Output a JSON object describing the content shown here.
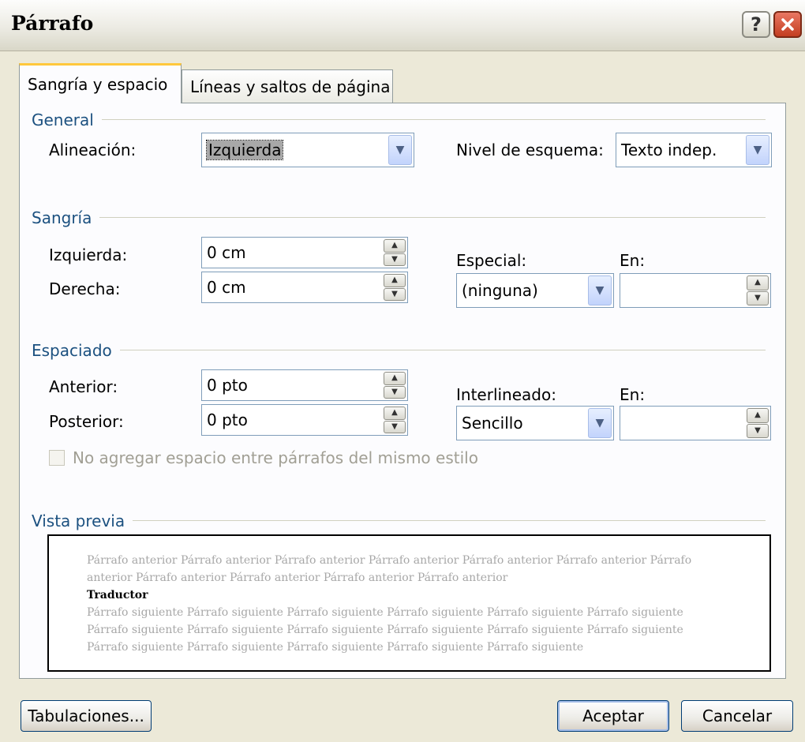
{
  "window": {
    "title": "Párrafo",
    "help_label": "?",
    "close_label": "✕"
  },
  "tabs": [
    {
      "label": "Sangría y espacio",
      "active": true
    },
    {
      "label": "Líneas y saltos de página",
      "active": false
    }
  ],
  "general": {
    "section_title": "General",
    "alineacion_label": "Alineación:",
    "alineacion_value": "Izquierda",
    "nivel_label": "Nivel de esquema:",
    "nivel_value": "Texto indep."
  },
  "sangria": {
    "section_title": "Sangría",
    "izquierda_label": "Izquierda:",
    "izquierda_value": "0 cm",
    "derecha_label": "Derecha:",
    "derecha_value": "0 cm",
    "especial_label": "Especial:",
    "especial_value": "(ninguna)",
    "en_label": "En:",
    "en_value": ""
  },
  "espaciado": {
    "section_title": "Espaciado",
    "anterior_label": "Anterior:",
    "anterior_value": "0 pto",
    "posterior_label": "Posterior:",
    "posterior_value": "0 pto",
    "interlineado_label": "Interlineado:",
    "interlineado_value": "Sencillo",
    "en_label": "En:",
    "en_value": "",
    "checkbox_label": "No agregar espacio entre párrafos del mismo estilo",
    "checkbox_checked": false
  },
  "preview": {
    "section_title": "Vista previa",
    "previous_text": "Párrafo anterior Párrafo anterior Párrafo anterior Párrafo anterior Párrafo anterior Párrafo anterior Párrafo anterior Párrafo anterior Párrafo anterior Párrafo anterior Párrafo anterior",
    "current_text": "Traductor",
    "next_text": "Párrafo siguiente Párrafo siguiente Párrafo siguiente Párrafo siguiente Párrafo siguiente Párrafo siguiente Párrafo siguiente Párrafo siguiente Párrafo siguiente Párrafo siguiente Párrafo siguiente Párrafo siguiente Párrafo siguiente Párrafo siguiente Párrafo siguiente Párrafo siguiente Párrafo siguiente"
  },
  "buttons": {
    "tabulaciones": "Tabulaciones...",
    "aceptar": "Aceptar",
    "cancelar": "Cancelar"
  },
  "colors": {
    "section_title": "#1c5180",
    "tab_highlight": "#ffc83c",
    "dialog_bg": "#ece9d8",
    "close_button": "#c33e21"
  },
  "icons": {
    "dropdown": "chevron-down-icon",
    "spinner": "spin-updown-icon",
    "help": "help-icon",
    "close": "close-icon"
  }
}
